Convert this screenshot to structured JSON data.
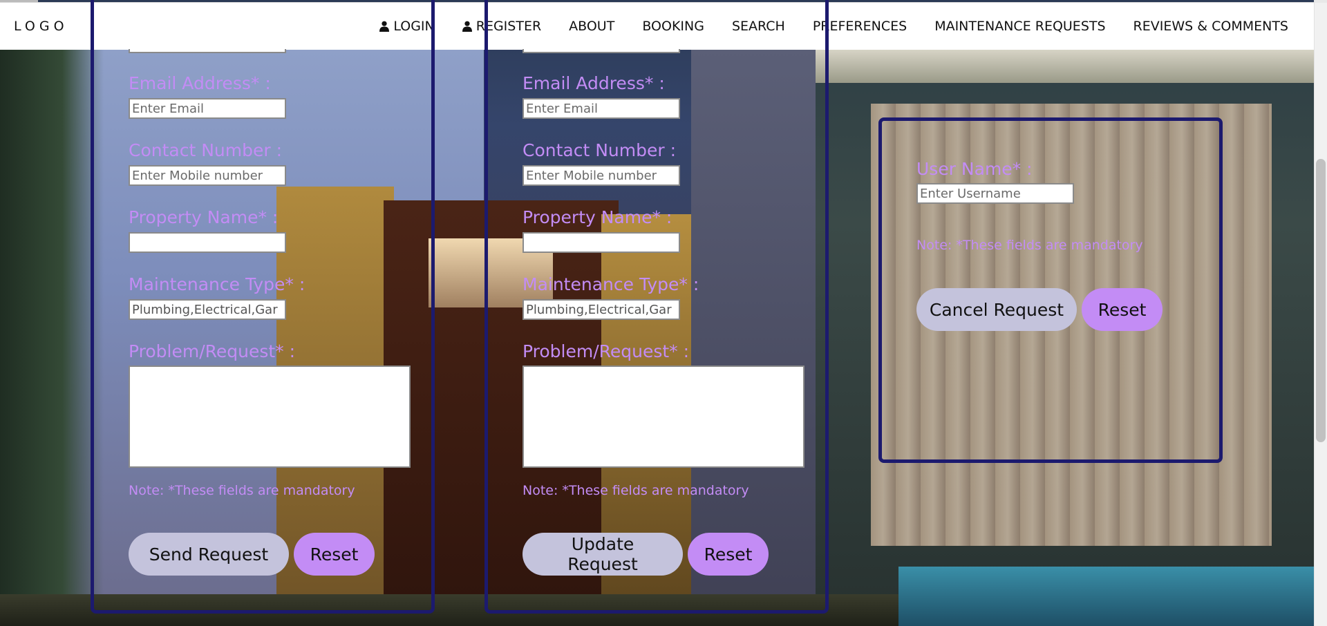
{
  "logo": "LOGO",
  "nav": {
    "login": "LOGIN",
    "register": "REGISTER",
    "about": "ABOUT",
    "booking": "BOOKING",
    "search": "SEARCH",
    "preferences": "PREFERENCES",
    "maintenance": "MAINTENANCE REQUESTS",
    "reviews": "REVIEWS & COMMENTS"
  },
  "send_form": {
    "email_label": "Email Address* :",
    "email_placeholder": "Enter Email",
    "contact_label": "Contact Number :",
    "contact_placeholder": "Enter Mobile number",
    "property_label": "Property Name* :",
    "property_value": "",
    "type_label": "Maintenance Type* :",
    "type_value": "Plumbing,Electrical,Gar",
    "problem_label": "Problem/Request* :",
    "problem_value": "",
    "note": "Note: *These fields are mandatory",
    "submit_label": "Send Request",
    "reset_label": "Reset"
  },
  "update_form": {
    "email_label": "Email Address* :",
    "email_placeholder": "Enter Email",
    "contact_label": "Contact Number :",
    "contact_placeholder": "Enter Mobile number",
    "property_label": "Property Name* :",
    "property_value": "",
    "type_label": "Maintenance Type* :",
    "type_value": "Plumbing,Electrical,Gar",
    "problem_label": "Problem/Request* :",
    "problem_value": "",
    "note": "Note: *These fields are mandatory",
    "submit_label": "Update Request",
    "reset_label": "Reset"
  },
  "cancel_form": {
    "username_label": "User Name* :",
    "username_placeholder": "Enter Username",
    "note": "Note: *These fields are mandatory",
    "submit_label": "Cancel Request",
    "reset_label": "Reset"
  },
  "colors": {
    "label": "#c38cf5",
    "panel_border": "#1c1a6e",
    "button_primary": "#c4c3dc",
    "button_reset": "#c38cf5"
  }
}
